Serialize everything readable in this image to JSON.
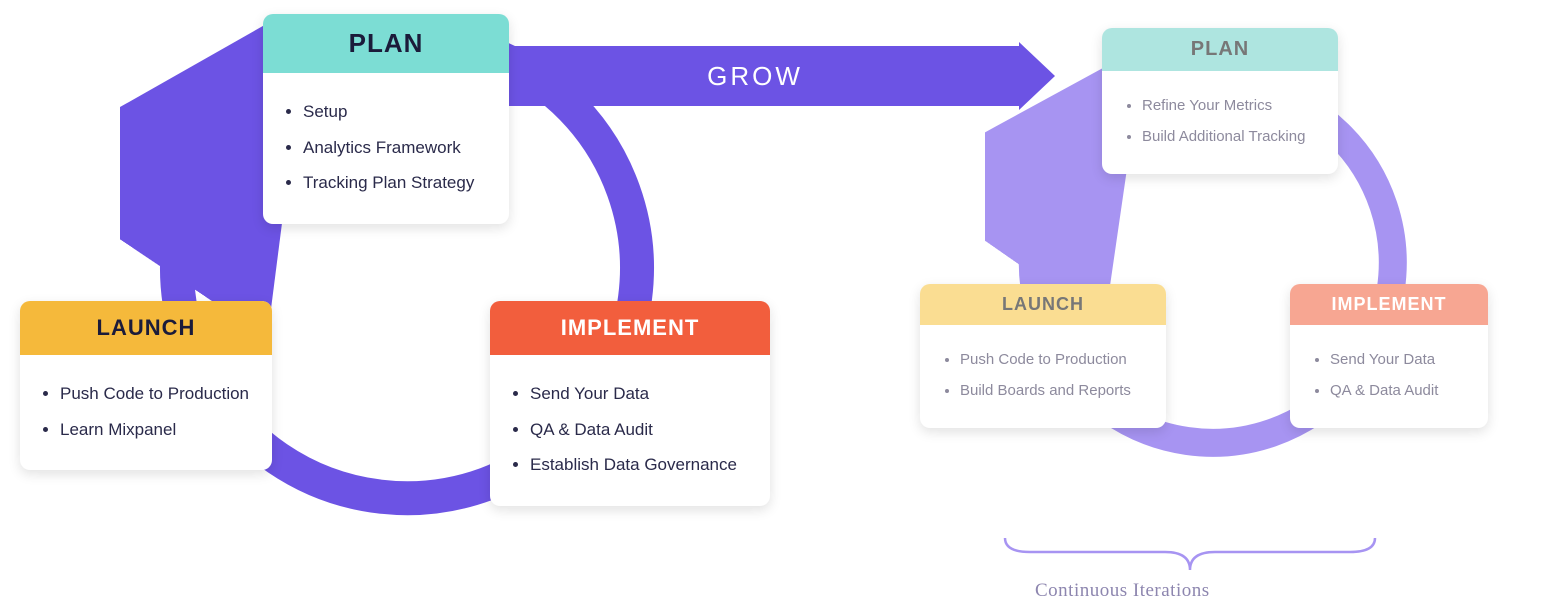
{
  "grow_label": "GROW",
  "cycle1": {
    "plan": {
      "title": "PLAN",
      "items": [
        "Setup",
        "Analytics Framework",
        "Tracking Plan Strategy"
      ]
    },
    "implement": {
      "title": "IMPLEMENT",
      "items": [
        "Send Your Data",
        "QA & Data Audit",
        "Establish Data Governance"
      ]
    },
    "launch": {
      "title": "LAUNCH",
      "items": [
        "Push Code to Production",
        "Learn Mixpanel"
      ]
    }
  },
  "cycle2": {
    "plan": {
      "title": "PLAN",
      "items": [
        "Refine Your Metrics",
        "Build Additional Tracking"
      ]
    },
    "implement": {
      "title": "IMPLEMENT",
      "items": [
        "Send Your Data",
        "QA & Data Audit"
      ]
    },
    "launch": {
      "title": "LAUNCH",
      "items": [
        "Push Code to Production",
        "Build Boards and Reports"
      ]
    }
  },
  "caption": "Continuous Iterations",
  "colors": {
    "cycle_main": "#6c53e4",
    "cycle_secondary": "#a794f2",
    "plan": "#7cddd4",
    "implement": "#f25e3d",
    "launch": "#f5b93b"
  }
}
